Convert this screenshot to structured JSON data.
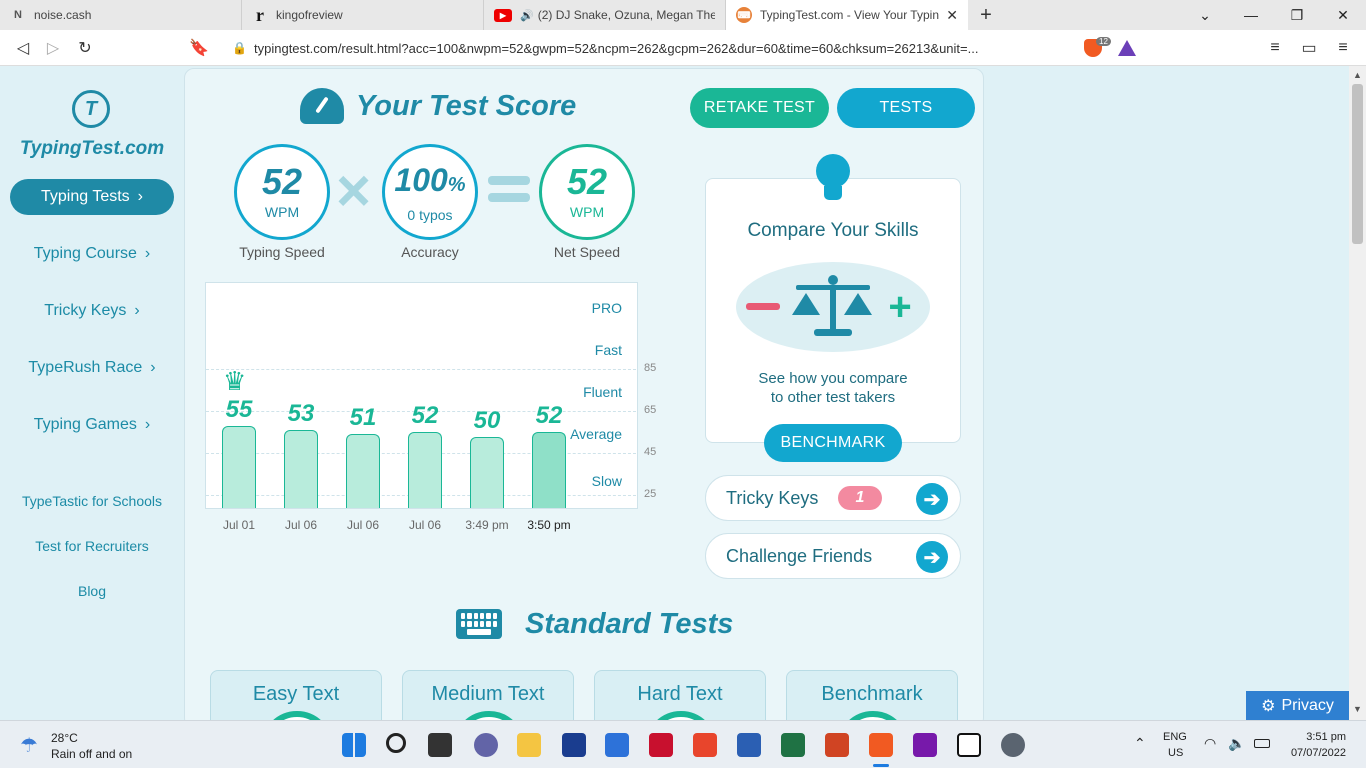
{
  "browser": {
    "tabs": [
      {
        "title": "noise.cash",
        "favicon": "N"
      },
      {
        "title": "kingofreview",
        "favicon": "r"
      },
      {
        "title": "(2) DJ Snake, Ozuna, Megan Thee",
        "favicon": "▶"
      },
      {
        "title": "TypingTest.com - View Your Typin",
        "favicon": "⌨"
      }
    ],
    "url": "typingtest.com/result.html?acc=100&nwpm=52&gwpm=52&ncpm=262&gcpm=262&dur=60&time=60&chksum=26213&unit=...",
    "shield_count": "12"
  },
  "sidebar": {
    "logo_text": "TypingTest.com",
    "nav": [
      {
        "label": "Typing Tests",
        "active": true
      },
      {
        "label": "Typing Course",
        "active": false
      },
      {
        "label": "Tricky Keys",
        "active": false
      },
      {
        "label": "TypeRush Race",
        "active": false
      },
      {
        "label": "Typing Games",
        "active": false
      }
    ],
    "links": [
      "TypeTastic for Schools",
      "Test for Recruiters",
      "Blog"
    ]
  },
  "result": {
    "title": "Your Test Score",
    "retake_label": "RETAKE TEST",
    "tests_label": "TESTS",
    "speed": {
      "value": "52",
      "unit": "WPM",
      "label": "Typing Speed"
    },
    "accuracy": {
      "value": "100",
      "percent": "%",
      "typos": "0  typos",
      "label": "Accuracy"
    },
    "net": {
      "value": "52",
      "unit": "WPM",
      "label": "Net Speed"
    }
  },
  "chart_data": {
    "type": "bar",
    "categories": [
      "Jul 01",
      "Jul 06",
      "Jul 06",
      "Jul 06",
      "3:49 pm",
      "3:50 pm"
    ],
    "values": [
      55,
      53,
      51,
      52,
      50,
      52
    ],
    "levels": [
      "PRO",
      "Fast",
      "Fluent",
      "Average",
      "Slow"
    ],
    "ticks": [
      85,
      65,
      45,
      25
    ],
    "best_index": 0,
    "current_index": 5
  },
  "compare": {
    "title": "Compare Your Skills",
    "line1": "See how you compare",
    "line2": "to other test takers",
    "button": "BENCHMARK"
  },
  "tricky_keys": {
    "label": "Tricky Keys",
    "count": "1"
  },
  "challenge": {
    "label": "Challenge Friends"
  },
  "standard": {
    "title": "Standard Tests",
    "cards": [
      "Easy Text",
      "Medium Text",
      "Hard Text",
      "Benchmark"
    ]
  },
  "privacy_label": "Privacy",
  "taskbar": {
    "weather_temp": "28°C",
    "weather_desc": "Rain off and on",
    "lang": "ENG",
    "region": "US",
    "time": "3:51 pm",
    "date": "07/07/2022"
  },
  "colors": {
    "teal": "#1f8aa6",
    "green": "#1ab796",
    "cyan": "#12a7cf"
  }
}
